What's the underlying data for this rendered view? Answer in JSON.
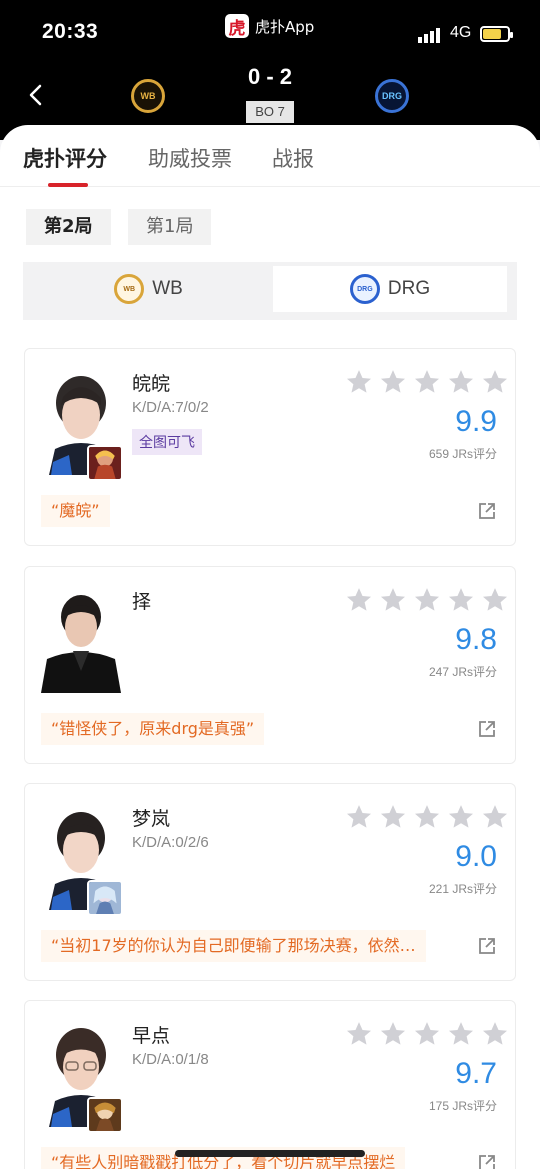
{
  "status_bar": {
    "time": "20:33",
    "app_label": "虎扑App",
    "app_logo_char": "虎",
    "network": "4G",
    "battery_color": "#f3d24a"
  },
  "header": {
    "score": "0 - 2",
    "series": "BO 7",
    "team_left_short": "WB",
    "team_right_short": "DRG"
  },
  "tabs": [
    {
      "label": "虎扑评分",
      "active": true
    },
    {
      "label": "助威投票",
      "active": false
    },
    {
      "label": "战报",
      "active": false
    }
  ],
  "games": [
    {
      "label": "第2局",
      "active": true
    },
    {
      "label": "第1局",
      "active": false
    }
  ],
  "team_switch": {
    "left_label": "WB",
    "right_label": "DRG",
    "selected": "DRG"
  },
  "players": [
    {
      "name": "皖皖",
      "kda": "K/D/A:7/0/2",
      "tag": "全图可飞",
      "score": "9.9",
      "count": "659 JRs评分",
      "quote": "“魔皖”",
      "hero_icon": "hero-portrait-red"
    },
    {
      "name": "择",
      "kda": "",
      "tag": "",
      "score": "9.8",
      "count": "247 JRs评分",
      "quote": "“错怪侠了，原来drg是真强”",
      "hero_icon": ""
    },
    {
      "name": "梦岚",
      "kda": "K/D/A:0/2/6",
      "tag": "",
      "score": "9.0",
      "count": "221 JRs评分",
      "quote": "“当初17岁的你认为自己即便输了那场决赛，依然…",
      "hero_icon": "hero-portrait-blue"
    },
    {
      "name": "早点",
      "kda": "K/D/A:0/1/8",
      "tag": "",
      "score": "9.7",
      "count": "175 JRs评分",
      "quote": "“有些人别暗戳戳打低分了，看个切片就早点摆烂",
      "hero_icon": "hero-portrait-gold"
    }
  ],
  "colors": {
    "accent": "#d8232a",
    "score_blue": "#2f8be3",
    "quote_text": "#e36a24",
    "quote_bg": "#fff7ef"
  }
}
